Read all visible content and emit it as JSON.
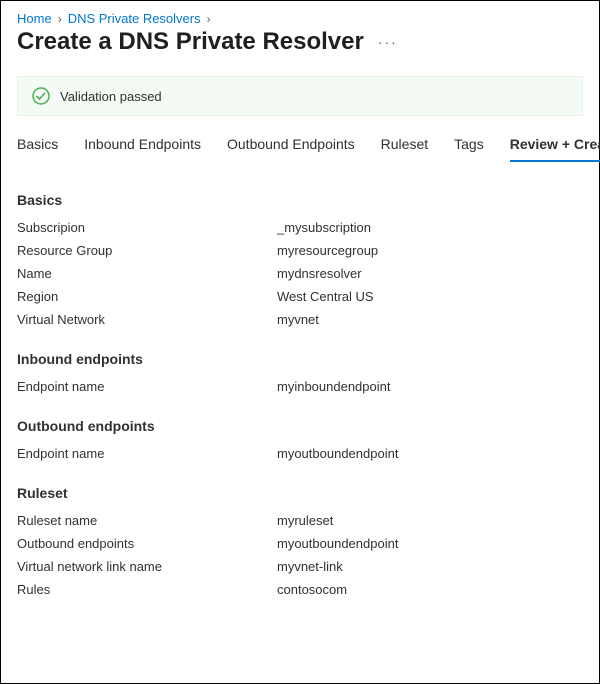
{
  "breadcrumb": {
    "home": "Home",
    "parent": "DNS Private Resolvers"
  },
  "title": "Create a DNS Private Resolver",
  "banner": {
    "text": "Validation passed"
  },
  "tabs": {
    "basics": "Basics",
    "inbound": "Inbound Endpoints",
    "outbound": "Outbound Endpoints",
    "ruleset": "Ruleset",
    "tags": "Tags",
    "review": "Review + Create"
  },
  "sections": {
    "basics_title": "Basics",
    "basics": {
      "subscription_k": "Subscripion",
      "subscription_v": "_mysubscription",
      "rg_k": "Resource Group",
      "rg_v": "myresourcegroup",
      "name_k": "Name",
      "name_v": "mydnsresolver",
      "region_k": "Region",
      "region_v": "West Central US",
      "vnet_k": "Virtual Network",
      "vnet_v": "myvnet"
    },
    "inbound_title": "Inbound endpoints",
    "inbound": {
      "ep_k": "Endpoint name",
      "ep_v": "myinboundendpoint"
    },
    "outbound_title": "Outbound endpoints",
    "outbound": {
      "ep_k": "Endpoint name",
      "ep_v": "myoutboundendpoint"
    },
    "ruleset_title": "Ruleset",
    "ruleset": {
      "name_k": "Ruleset name",
      "name_v": "myruleset",
      "ob_k": "Outbound endpoints",
      "ob_v": "myoutboundendpoint",
      "link_k": "Virtual network link name",
      "link_v": "myvnet-link",
      "rules_k": "Rules",
      "rules_v": "contosocom"
    }
  }
}
